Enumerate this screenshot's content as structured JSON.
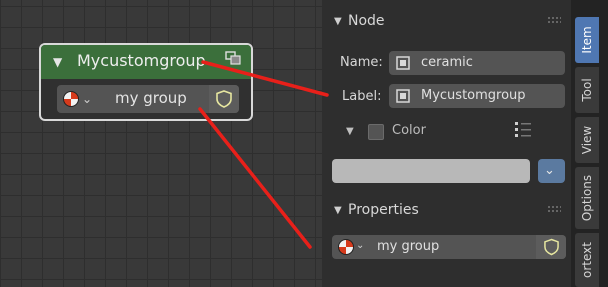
{
  "node": {
    "title": "Mycustomgroup",
    "datablock_value": "my group",
    "icons": {
      "collapse": "triangle-down-icon",
      "header": "node-group-icon",
      "material": "material-ball-icon",
      "dropdown": "chevron-down-icon",
      "fake_user": "shield-icon"
    }
  },
  "panel": {
    "node_section": {
      "title": "Node"
    },
    "name_label": "Name:",
    "name_value": "ceramic",
    "label_label": "Label:",
    "label_value": "Mycustomgroup",
    "color_section": {
      "title": "Color",
      "checked": false
    },
    "color_swatch": "#b8b8b8",
    "properties_section": {
      "title": "Properties"
    },
    "properties_value": "my group"
  },
  "tabs": [
    {
      "label": "Item",
      "active": true
    },
    {
      "label": "Tool",
      "active": false
    },
    {
      "label": "View",
      "active": false
    },
    {
      "label": "Options",
      "active": false
    },
    {
      "label": "ortext",
      "active": false
    }
  ],
  "colors": {
    "accent": "#4f77b2",
    "node_header": "#3b6f3b",
    "annotation": "#e8201a"
  }
}
